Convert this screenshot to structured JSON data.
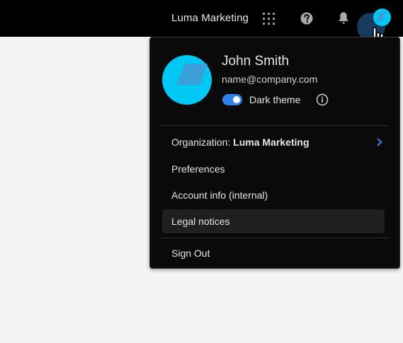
{
  "header": {
    "org_name": "Luma Marketing",
    "icons": [
      "apps-grid-icon",
      "help-icon",
      "notifications-bell-icon",
      "user-avatar"
    ]
  },
  "profile_menu": {
    "user_name": "John Smith",
    "email": "name@company.com",
    "dark_theme_label": "Dark theme",
    "dark_theme_enabled": true,
    "organization_prefix": "Organization:",
    "organization_name": "Luma Marketing",
    "items": [
      {
        "label": "Preferences"
      },
      {
        "label": "Account info (internal)"
      },
      {
        "label": "Legal notices"
      }
    ],
    "sign_out_label": "Sign Out"
  },
  "colors": {
    "topbar_bg": "#000000",
    "menu_bg": "#0a0a0a",
    "page_bg": "#f4f4f4",
    "accent": "#2f80ed",
    "avatar_cyan": "#00c8f5"
  }
}
